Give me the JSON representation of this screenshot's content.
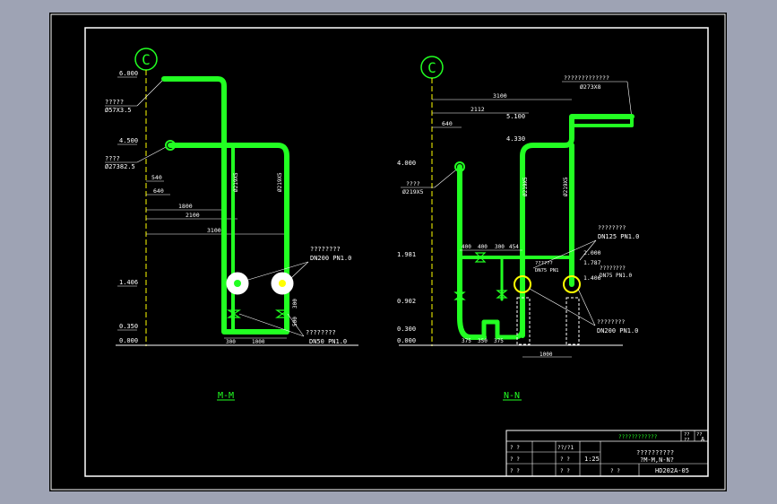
{
  "colors": {
    "background": "#9ea3b4",
    "sheet": "#000000",
    "frame": "#ffffff",
    "pipe": "#22ff22",
    "text": "#ffffff",
    "grid_line": "#ffff00",
    "view_label": "#22ff22",
    "title_block_header": "#22ff22"
  },
  "view_mm": {
    "axis_label": "C",
    "elevations": [
      "6.000",
      "4.500",
      "1.406",
      "0.350",
      "0.000"
    ],
    "dimensions": [
      "540",
      "640",
      "1800",
      "2100",
      "3100",
      "300",
      "1000",
      "300",
      "500"
    ],
    "annotations": {
      "pipe_top": "?????",
      "pipe_top_size": "Ø57X3.5",
      "pipe_mid": "????",
      "pipe_mid_size": "Ø27382.5",
      "valve_big": "????????",
      "valve_big_size": "DN200 PN1.0",
      "valve_small": "????????",
      "valve_small_size": "DN50 PN1.0",
      "vertical_left": "Ø219X5",
      "vertical_right": "Ø219X5"
    },
    "label": "M-M"
  },
  "view_nn": {
    "axis_label": "C",
    "elevations_left": [
      "4.000",
      "1.981",
      "0.902",
      "0.300",
      "0.000"
    ],
    "elevations_right": [
      "5.100",
      "4.330",
      "2.000",
      "1.787",
      "1.406"
    ],
    "dimensions": [
      "3100",
      "2112",
      "640",
      "400",
      "400",
      "300",
      "454",
      "375",
      "350",
      "375",
      "1000"
    ],
    "annotations": {
      "top_right": "?????????????",
      "top_right_size": "Ø273X8",
      "left_pipe": "????",
      "left_pipe_size": "Ø219X5",
      "valve_125": "????????",
      "valve_125_size": "DN125 PN1.0",
      "reducer": "????????",
      "reducer_size": "DN75 PN1.0",
      "valve_200": "????????",
      "valve_200_size": "DN200 PN1.0",
      "mid_note": "??????",
      "mid_note_size": "DN75 PN1",
      "vertical_a": "Ø219X5",
      "vertical_b": "Ø219X5"
    },
    "label": "N-N"
  },
  "title_block": {
    "header": "????????????",
    "header_right": [
      "??",
      "??",
      "??"
    ],
    "sheet_mark": "A",
    "drawing_title_1": "??????????",
    "drawing_title_2": "?M-M,N-N?",
    "scale": "1:25",
    "drawing_no": "HD202A-05",
    "cells": [
      "? ?",
      "? ?",
      "? ?",
      "??/?1",
      "? ?",
      "? ?",
      "? ?"
    ]
  }
}
